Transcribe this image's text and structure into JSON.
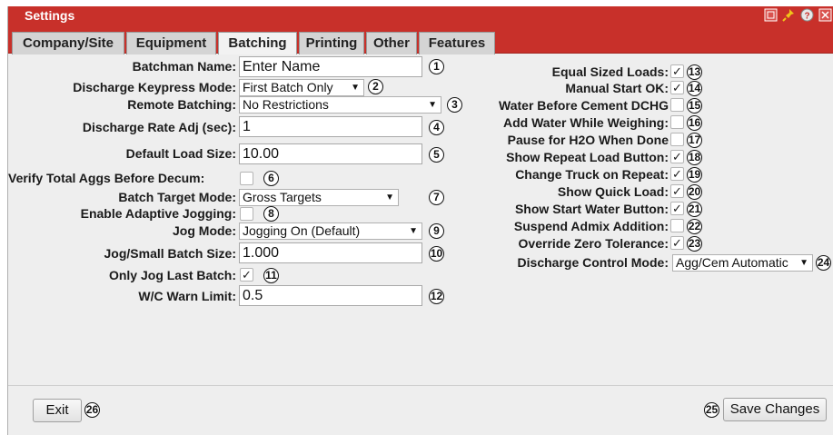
{
  "window": {
    "title": "Settings"
  },
  "title_icons": [
    "restore-icon",
    "pin-icon",
    "help-icon",
    "close-icon"
  ],
  "tabs": [
    {
      "label": "Company/Site",
      "active": false
    },
    {
      "label": "Equipment",
      "active": false
    },
    {
      "label": "Batching",
      "active": true
    },
    {
      "label": "Printing",
      "active": false
    },
    {
      "label": "Other",
      "active": false
    },
    {
      "label": "Features",
      "active": false
    }
  ],
  "left": {
    "batchman_name": {
      "label": "Batchman Name:",
      "value": "Enter Name",
      "marker": "1"
    },
    "discharge_keypress_mode": {
      "label": "Discharge Keypress Mode:",
      "value": "First Batch Only",
      "marker": "2"
    },
    "remote_batching": {
      "label": "Remote Batching:",
      "value": "No Restrictions",
      "marker": "3"
    },
    "discharge_rate_adj": {
      "label": "Discharge Rate Adj (sec):",
      "value": "1",
      "marker": "4"
    },
    "default_load_size": {
      "label": "Default Load Size:",
      "value": "10.00",
      "marker": "5"
    },
    "verify_total_aggs": {
      "label": "Verify Total Aggs Before Decum:",
      "checked": false,
      "marker": "6"
    },
    "batch_target_mode": {
      "label": "Batch Target Mode:",
      "value": "Gross Targets",
      "marker": "7"
    },
    "enable_adaptive_jogging": {
      "label": "Enable Adaptive Jogging:",
      "checked": false,
      "marker": "8"
    },
    "jog_mode": {
      "label": "Jog Mode:",
      "value": "Jogging On (Default)",
      "marker": "9"
    },
    "jog_small_batch_size": {
      "label": "Jog/Small Batch Size:",
      "value": "1.000",
      "marker": "10"
    },
    "only_jog_last_batch": {
      "label": "Only Jog Last Batch:",
      "checked": true,
      "marker": "11"
    },
    "wc_warn_limit": {
      "label": "W/C Warn Limit:",
      "value": "0.5",
      "marker": "12"
    }
  },
  "right": {
    "equal_sized_loads": {
      "label": "Equal Sized Loads:",
      "checked": true,
      "marker": "13"
    },
    "manual_start_ok": {
      "label": "Manual Start OK:",
      "checked": true,
      "marker": "14"
    },
    "water_before_cement": {
      "label": "Water Before Cement DCHG",
      "checked": false,
      "marker": "15"
    },
    "add_water_while_weighing": {
      "label": "Add Water While Weighing:",
      "checked": false,
      "marker": "16"
    },
    "pause_for_h2o": {
      "label": "Pause for H2O When Done",
      "checked": false,
      "marker": "17"
    },
    "show_repeat_load": {
      "label": "Show Repeat Load Button:",
      "checked": true,
      "marker": "18"
    },
    "change_truck_on_repeat": {
      "label": "Change Truck on Repeat:",
      "checked": true,
      "marker": "19"
    },
    "show_quick_load": {
      "label": "Show Quick Load:",
      "checked": true,
      "marker": "20"
    },
    "show_start_water": {
      "label": "Show Start Water Button:",
      "checked": true,
      "marker": "21"
    },
    "suspend_admix": {
      "label": "Suspend Admix Addition:",
      "checked": false,
      "marker": "22"
    },
    "override_zero_tolerance": {
      "label": "Override Zero Tolerance:",
      "checked": true,
      "marker": "23"
    },
    "discharge_control_mode": {
      "label": "Discharge Control Mode:",
      "value": "Agg/Cem Automatic",
      "marker": "24"
    }
  },
  "footer": {
    "exit_label": "Exit",
    "exit_marker": "26",
    "save_label": "Save Changes",
    "save_marker": "25"
  },
  "glyphs": {
    "check": "✓",
    "dropdown": "▼"
  },
  "colors": {
    "titlebar": "#c8302a",
    "panel": "#eeeeee"
  }
}
